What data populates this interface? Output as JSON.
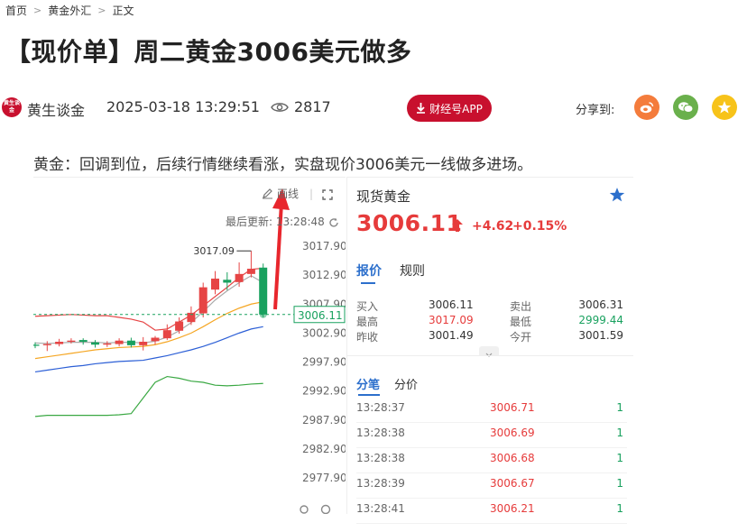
{
  "breadcrumb": [
    {
      "label": "首页"
    },
    {
      "label": "黄金外汇"
    },
    {
      "label": "正文"
    }
  ],
  "breadcrumb_sep": ">",
  "article": {
    "title": "【现价单】周二黄金3006美元做多",
    "author": "黄生谈金",
    "avatar_text": "黄生谈金",
    "datetime": "2025-03-18 13:29:51",
    "views": "2817",
    "app_button": "财经号APP",
    "share_label": "分享到:",
    "lead": "黄金：回调到位，后续行情继续看涨，实盘现价3006美元一线做多进场。"
  },
  "chart_tools": {
    "draw_label": "画线",
    "updated_label": "最后更新: 13:28:48"
  },
  "chart_data": {
    "type": "candlestick",
    "y_ticks": [
      "3017.90",
      "3012.90",
      "3007.90",
      "3002.90",
      "2997.90",
      "2992.90",
      "2987.90",
      "2982.90",
      "2977.90"
    ],
    "y_tick_values": [
      3017.9,
      3012.9,
      3007.9,
      3002.9,
      2997.9,
      2992.9,
      2987.9,
      2982.9,
      2977.9
    ],
    "high_annotation": "3017.09",
    "current_price_label": "3006.11",
    "current_price": 3006.11,
    "candles": [
      {
        "o": 3000.9,
        "c": 3000.7,
        "h": 3001.3,
        "l": 3000.3
      },
      {
        "o": 3000.8,
        "c": 3001.0,
        "h": 3001.5,
        "l": 2999.8
      },
      {
        "o": 3001.0,
        "c": 3001.4,
        "h": 3001.9,
        "l": 3000.6
      },
      {
        "o": 3001.4,
        "c": 3001.6,
        "h": 3002.0,
        "l": 3001.1
      },
      {
        "o": 3001.7,
        "c": 3001.4,
        "h": 3002.0,
        "l": 3000.9
      },
      {
        "o": 3001.3,
        "c": 3000.9,
        "h": 3001.7,
        "l": 3000.4
      },
      {
        "o": 3000.9,
        "c": 3001.1,
        "h": 3001.5,
        "l": 3000.5
      },
      {
        "o": 3001.0,
        "c": 3001.6,
        "h": 3002.0,
        "l": 3000.6
      },
      {
        "o": 3001.6,
        "c": 3000.8,
        "h": 3002.1,
        "l": 3000.4
      },
      {
        "o": 3000.8,
        "c": 3001.4,
        "h": 3002.2,
        "l": 2999.9
      },
      {
        "o": 3001.5,
        "c": 3002.1,
        "h": 3002.4,
        "l": 3000.9
      },
      {
        "o": 3002.0,
        "c": 3003.4,
        "h": 3004.4,
        "l": 3001.7
      },
      {
        "o": 3003.3,
        "c": 3004.9,
        "h": 3005.6,
        "l": 3002.8
      },
      {
        "o": 3004.8,
        "c": 3006.4,
        "h": 3007.5,
        "l": 3004.3
      },
      {
        "o": 3006.3,
        "c": 3010.8,
        "h": 3011.6,
        "l": 3005.6
      },
      {
        "o": 3010.4,
        "c": 3012.3,
        "h": 3013.6,
        "l": 3009.6
      },
      {
        "o": 3012.1,
        "c": 3011.6,
        "h": 3013.4,
        "l": 3010.3
      },
      {
        "o": 3011.7,
        "c": 3013.1,
        "h": 3015.1,
        "l": 3010.9
      },
      {
        "o": 3013.1,
        "c": 3014.0,
        "h": 3017.09,
        "l": 3012.5
      },
      {
        "o": 3014.2,
        "c": 3006.11,
        "h": 3014.9,
        "l": 3005.6
      }
    ],
    "ma_lines": [
      {
        "color": "#e64545",
        "values": [
          3005.8,
          3005.9,
          3006.0,
          3006.1,
          3006.0,
          3005.9,
          3005.9,
          3005.6,
          3005.3,
          3004.8,
          3003.4,
          3003.6,
          3004.8,
          3006.0,
          3007.6,
          3009.2,
          3010.8,
          3012.5,
          3013.9,
          3014.1
        ]
      },
      {
        "color": "#aaaaaa",
        "values": [
          3001.2,
          3001.1,
          3001.2,
          3001.3,
          3001.3,
          3001.3,
          3001.2,
          3001.3,
          3001.3,
          3001.2,
          3001.5,
          3002.2,
          3003.3,
          3004.7,
          3006.6,
          3008.6,
          3010.2,
          3011.6,
          3012.8,
          3011.6
        ]
      },
      {
        "color": "#f5a623",
        "values": [
          2998.5,
          2998.8,
          2999.1,
          2999.4,
          2999.7,
          3000.0,
          3000.2,
          3000.4,
          3000.5,
          3000.6,
          3000.9,
          3001.4,
          3002.1,
          3002.9,
          3004.0,
          3005.2,
          3006.3,
          3007.2,
          3007.9,
          3008.3
        ]
      },
      {
        "color": "#2c5fd6",
        "values": [
          2996.2,
          2996.5,
          2996.8,
          2997.1,
          2997.3,
          2997.6,
          2997.8,
          2998.0,
          2998.1,
          2998.2,
          2998.6,
          2999.0,
          2999.5,
          3000.0,
          3000.6,
          3001.3,
          3002.1,
          3002.9,
          3003.6,
          3004.0
        ]
      }
    ],
    "indicator_line": {
      "color": "#3aa843",
      "values": [
        2988.5,
        2988.7,
        2988.7,
        2988.7,
        2988.7,
        2988.7,
        2988.7,
        2988.8,
        2989.0,
        2991.7,
        2994.4,
        2995.4,
        2995.1,
        2994.6,
        2994.4,
        2993.9,
        2993.8,
        2993.9,
        2994.1,
        2994.2
      ]
    },
    "ylim": [
      2977.9,
      3017.9
    ],
    "up_color": "#e64545",
    "down_color": "#19a15f"
  },
  "quote": {
    "name": "现货黄金",
    "price": "3006.11",
    "change": "+4.62",
    "change_pct": "+0.15%",
    "tabs": [
      "报价",
      "规则"
    ],
    "stats": [
      {
        "label1": "买入",
        "value1": "3006.11",
        "label2": "卖出",
        "value2": "3006.31"
      },
      {
        "label1": "最高",
        "value1": "3017.09",
        "label2": "最低",
        "value2": "2999.44"
      },
      {
        "label1": "昨收",
        "value1": "3001.49",
        "label2": "今开",
        "value2": "3001.59"
      }
    ],
    "sub_tabs": [
      "分笔",
      "分价"
    ],
    "ticks": [
      {
        "time": "13:28:37",
        "price": "3006.71",
        "vol": "1"
      },
      {
        "time": "13:28:38",
        "price": "3006.69",
        "vol": "1"
      },
      {
        "time": "13:28:38",
        "price": "3006.68",
        "vol": "1"
      },
      {
        "time": "13:28:39",
        "price": "3006.67",
        "vol": "1"
      },
      {
        "time": "13:28:41",
        "price": "3006.21",
        "vol": "1"
      }
    ]
  },
  "colors": {
    "accent": "#2c6fcc",
    "up": "#e63b3b",
    "down": "#19a15f",
    "brand": "#c8102e"
  }
}
